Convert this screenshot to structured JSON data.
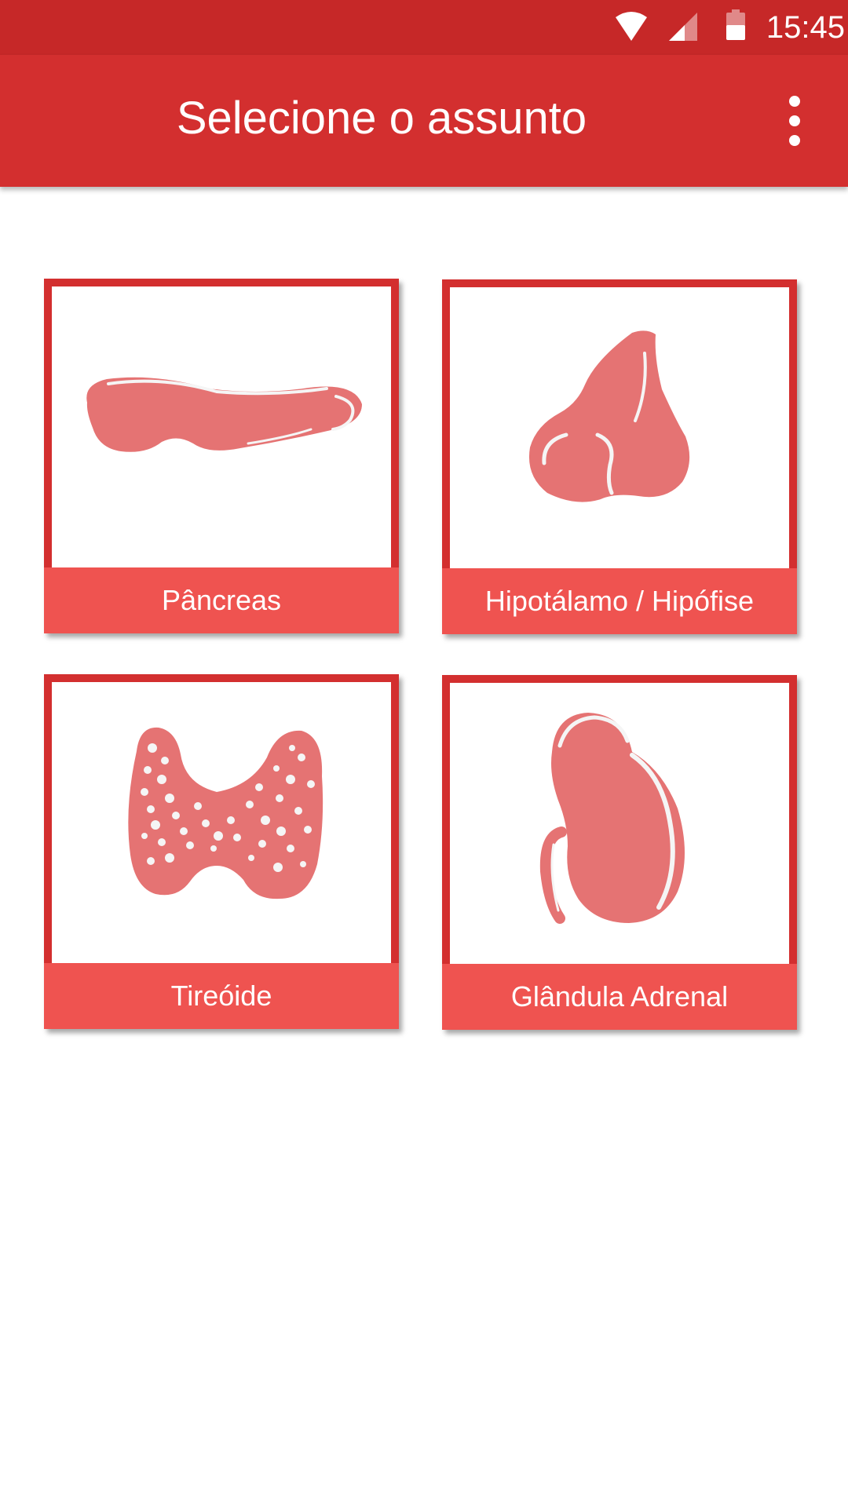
{
  "status_bar": {
    "time": "15:45",
    "icons": [
      "wifi-icon",
      "cell-signal-icon",
      "battery-icon"
    ]
  },
  "app_bar": {
    "title": "Selecione o assunto",
    "menu_icon": "more-vert-icon"
  },
  "topics": [
    {
      "label": "Pâncreas",
      "icon": "pancreas-illustration"
    },
    {
      "label": "Hipotálamo / Hipófise",
      "icon": "pituitary-illustration"
    },
    {
      "label": "Tireóide",
      "icon": "thyroid-illustration"
    },
    {
      "label": "Glândula Adrenal",
      "icon": "adrenal-kidney-illustration"
    }
  ],
  "colors": {
    "status_bar": "#c62828",
    "app_bar": "#d32f2f",
    "card_border": "#d32f2f",
    "card_label_bg": "#ef5350",
    "organ_fill": "#e57373",
    "highlight": "#f5f5f5"
  }
}
